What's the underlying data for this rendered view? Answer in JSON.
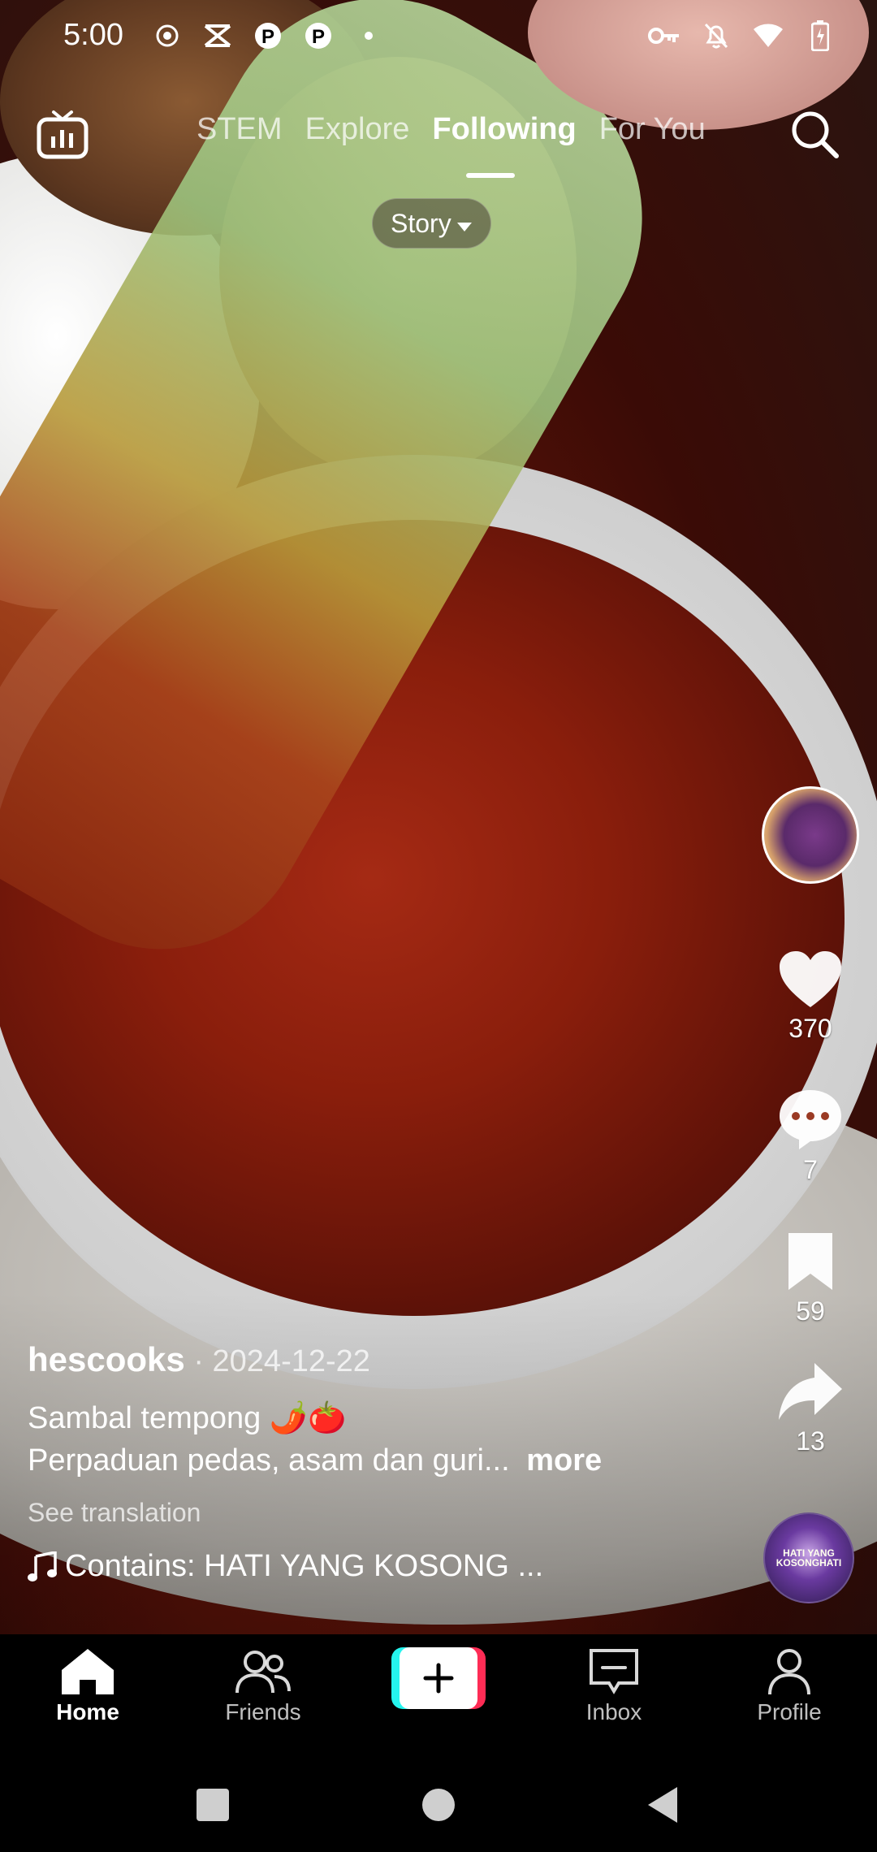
{
  "status_bar": {
    "time": "5:00",
    "left_icons": [
      "record-icon",
      "app-icon",
      "pinterest-icon",
      "pinterest-icon",
      "dot-icon"
    ],
    "right_icons": [
      "key-icon",
      "bell-off-icon",
      "wifi-icon",
      "battery-icon"
    ]
  },
  "top_nav": {
    "tabs": [
      {
        "label": "STEM",
        "active": false
      },
      {
        "label": "Explore",
        "active": false
      },
      {
        "label": "Following",
        "active": true
      },
      {
        "label": "For You",
        "active": false
      }
    ],
    "live_icon": "tv-icon",
    "search_icon": "search-icon"
  },
  "story_pill": {
    "label": "Story"
  },
  "actions": {
    "likes": "370",
    "comments": "7",
    "bookmarks": "59",
    "shares": "13"
  },
  "post": {
    "author": "hescooks",
    "date": " · 2024-12-22",
    "title_line": "Sambal tempong 🌶️🍅",
    "desc_line": "Perpaduan pedas, asam dan guri...",
    "more_label": "more",
    "see_translation": "See translation",
    "music": "Contains: HATI YANG KOSONG ...",
    "disc_text": "HATI YANG KOSONGHATI"
  },
  "bottom_nav": {
    "items": [
      {
        "label": "Home",
        "icon": "home-icon",
        "active": true
      },
      {
        "label": "Friends",
        "icon": "friends-icon",
        "active": false
      },
      {
        "label": "",
        "icon": "plus-icon",
        "active": false
      },
      {
        "label": "Inbox",
        "icon": "inbox-icon",
        "active": false
      },
      {
        "label": "Profile",
        "icon": "profile-icon",
        "active": false
      }
    ]
  },
  "colors": {
    "accent_cyan": "#25f4ee",
    "accent_red": "#fe2c55",
    "nav_bg": "#000000"
  }
}
